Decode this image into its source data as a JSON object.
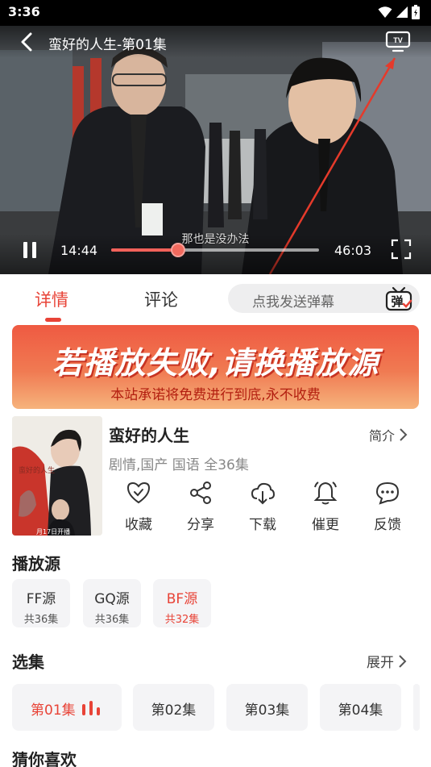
{
  "status_bar": {
    "time": "3:36"
  },
  "player": {
    "title": "蛮好的人生-第01集",
    "subtitle": "那也是没办法",
    "current_time": "14:44",
    "total_time": "46:03",
    "progress": 0.32,
    "accent_color": "#f2615a"
  },
  "tabs": [
    {
      "label": "详情",
      "active": true
    },
    {
      "label": "评论",
      "active": false
    }
  ],
  "danmu": {
    "placeholder": "点我发送弹幕",
    "icon_text": "弹"
  },
  "banner": {
    "main_text": "若播放失败,请换播放源",
    "sub_text": "本站承诺将免费进行到底,永不收费"
  },
  "show": {
    "title": "蛮好的人生",
    "meta": "剧情,国产 国语 全36集",
    "intro_label": "简介",
    "poster_text": "蛮好的人生",
    "poster_date": "月17日开播"
  },
  "actions": [
    {
      "label": "收藏",
      "icon": "heart-check-icon"
    },
    {
      "label": "分享",
      "icon": "share-icon"
    },
    {
      "label": "下载",
      "icon": "cloud-download-icon"
    },
    {
      "label": "催更",
      "icon": "bell-icon"
    },
    {
      "label": "反馈",
      "icon": "chat-bubble-icon"
    }
  ],
  "sources": {
    "title": "播放源",
    "items": [
      {
        "name": "FF源",
        "count": "共36集",
        "active": false
      },
      {
        "name": "GQ源",
        "count": "共36集",
        "active": false
      },
      {
        "name": "BF源",
        "count": "共32集",
        "active": true
      }
    ]
  },
  "episodes": {
    "title": "选集",
    "expand_label": "展开",
    "items": [
      {
        "label": "第01集",
        "active": true
      },
      {
        "label": "第02集",
        "active": false
      },
      {
        "label": "第03集",
        "active": false
      },
      {
        "label": "第04集",
        "active": false
      }
    ]
  },
  "guess": {
    "title": "猜你喜欢"
  },
  "colors": {
    "accent": "#e84337",
    "background": "#ffffff",
    "card": "#f4f4f6"
  }
}
